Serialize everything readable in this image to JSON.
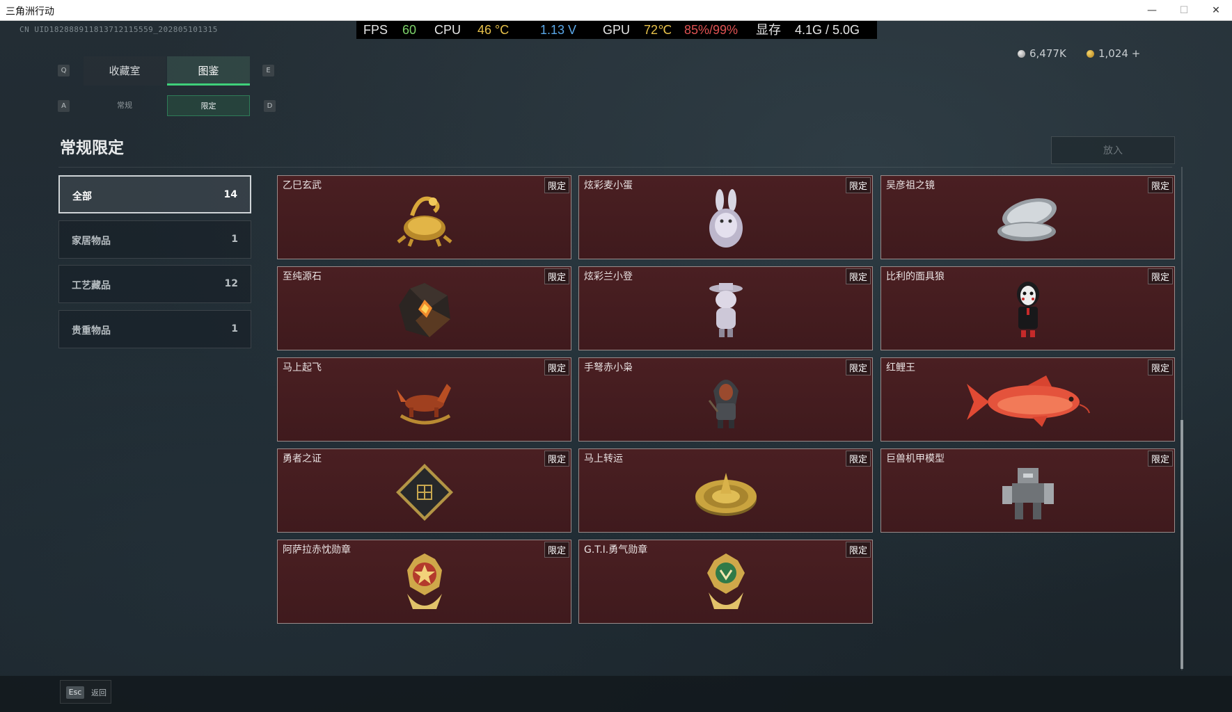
{
  "window": {
    "title": "三角洲行动",
    "minimize": "—",
    "maximize": "☐",
    "close": "✕"
  },
  "uid": "CN UID182888911813712115559_202805101315",
  "perf": {
    "fps_label": "FPS",
    "fps_value": "60",
    "cpu_label": "CPU",
    "cpu_temp": "46 °C",
    "voltage": "1.13 V",
    "gpu_label": "GPU",
    "gpu_temp": "72℃",
    "gpu_usage": "85%/99%",
    "vram_label": "显存",
    "vram_value": "4.1G / 5.0G"
  },
  "currency": {
    "silver": "6,477K",
    "gold": "1,024 +"
  },
  "tabs": {
    "key_left": "Q",
    "key_right": "E",
    "items": [
      {
        "label": "收藏室"
      },
      {
        "label": "图鉴"
      }
    ]
  },
  "subtabs": {
    "key_left": "A",
    "key_right": "D",
    "items": [
      {
        "label": "常规"
      },
      {
        "label": "限定"
      }
    ]
  },
  "section_title": "常规限定",
  "put_button": "放入",
  "categories": [
    {
      "name": "全部",
      "count": "14"
    },
    {
      "name": "家居物品",
      "count": "1"
    },
    {
      "name": "工艺藏品",
      "count": "12"
    },
    {
      "name": "贵重物品",
      "count": "1"
    }
  ],
  "badge_label": "限定",
  "items": [
    {
      "name": "乙巳玄武",
      "icon": "dragon-turtle-icon"
    },
    {
      "name": "炫彩麦小蛋",
      "icon": "bunny-egg-icon"
    },
    {
      "name": "吴彦祖之镜",
      "icon": "compact-mirror-icon"
    },
    {
      "name": "至纯源石",
      "icon": "gem-stone-icon"
    },
    {
      "name": "炫彩兰小登",
      "icon": "figurine-icon"
    },
    {
      "name": "比利的面具狼",
      "icon": "mask-puppet-icon"
    },
    {
      "name": "马上起飞",
      "icon": "rocking-horse-icon"
    },
    {
      "name": "手弩赤小枭",
      "icon": "hooded-figure-icon"
    },
    {
      "name": "红鲤王",
      "icon": "red-carp-icon"
    },
    {
      "name": "勇者之证",
      "icon": "card-token-icon"
    },
    {
      "name": "马上转运",
      "icon": "gold-dial-icon"
    },
    {
      "name": "巨兽机甲模型",
      "icon": "mech-model-icon"
    },
    {
      "name": "阿萨拉赤忱勋章",
      "icon": "medal-red-icon"
    },
    {
      "name": "G.T.I.勇气勋章",
      "icon": "medal-green-icon"
    }
  ],
  "esc": {
    "key": "Esc",
    "label": "返回"
  }
}
